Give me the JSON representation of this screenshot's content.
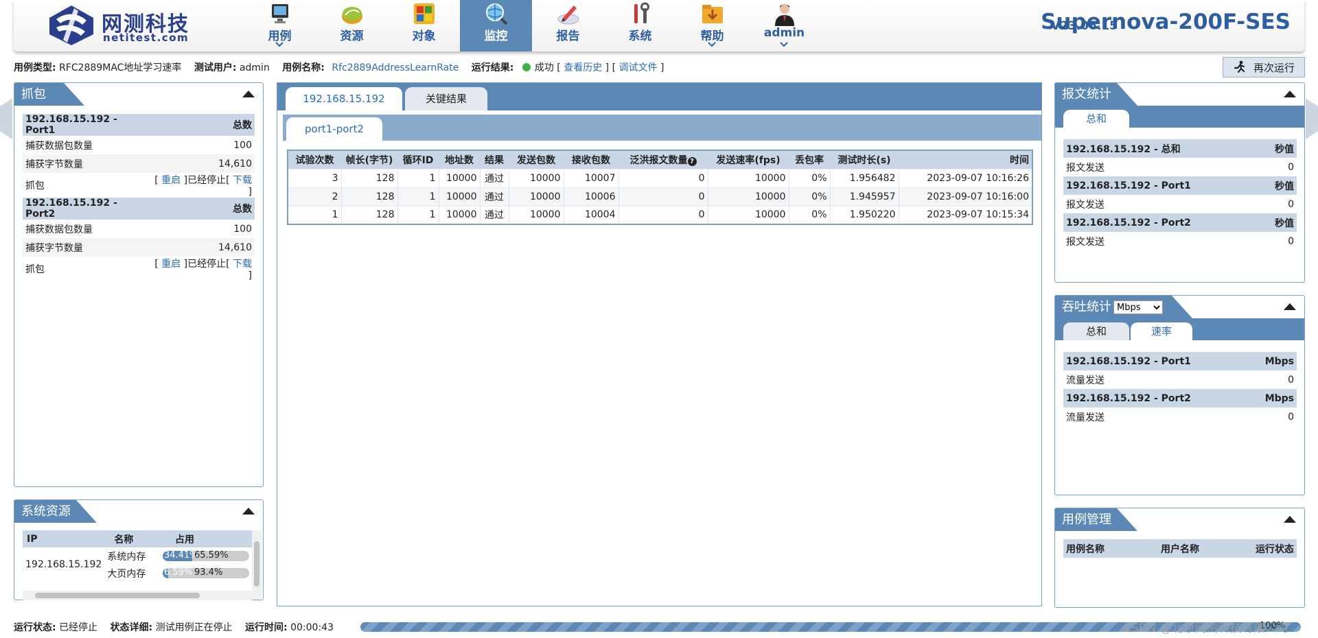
{
  "header": {
    "logo_cn": "网测科技",
    "logo_en": "netitest.com",
    "nav": [
      {
        "label": "用例",
        "has_dropdown": true
      },
      {
        "label": "资源",
        "has_dropdown": false
      },
      {
        "label": "对象",
        "has_dropdown": false
      },
      {
        "label": "监控",
        "has_dropdown": false,
        "active": true
      },
      {
        "label": "报告",
        "has_dropdown": false
      },
      {
        "label": "系统",
        "has_dropdown": false
      },
      {
        "label": "帮助",
        "has_dropdown": true
      },
      {
        "label": "admin",
        "has_dropdown": true
      }
    ],
    "version": "V23.06.15",
    "product": "Supernova-200F-SES"
  },
  "infobar": {
    "case_type_label": "用例类型:",
    "case_type_value": "RFC2889MAC地址学习速率",
    "user_label": "测试用户:",
    "user_value": "admin",
    "case_name_label": "用例名称:",
    "case_name_value": "Rfc2889AddressLearnRate",
    "result_label": "运行结果:",
    "result_value": "成功 [",
    "history_link": "查看历史",
    "sep": "] [",
    "debug_link": "调试文件",
    "close": "]",
    "rerun_button": "再次运行"
  },
  "capture": {
    "title": "抓包",
    "ports": [
      {
        "name": "192.168.15.192 - Port1",
        "total_label": "总数",
        "pkt_label": "捕获数据包数量",
        "pkt_value": "100",
        "byte_label": "捕获字节数量",
        "byte_value": "14,610",
        "cap_label": "抓包",
        "restart": "重启",
        "stopped": "]已经停止[",
        "download": "下载",
        "open": "[",
        "close": "]"
      },
      {
        "name": "192.168.15.192 - Port2",
        "total_label": "总数",
        "pkt_label": "捕获数据包数量",
        "pkt_value": "100",
        "byte_label": "捕获字节数量",
        "byte_value": "14,610",
        "cap_label": "抓包",
        "restart": "重启",
        "stopped": "]已经停止[",
        "download": "下载",
        "open": "[",
        "close": "]"
      }
    ]
  },
  "sysres": {
    "title": "系统资源",
    "headers": [
      "IP",
      "名称",
      "占用"
    ],
    "ip": "192.168.15.192",
    "rows": [
      {
        "name": "系统内存",
        "used": "34.41%",
        "free": "65.59%",
        "used_pct": 34.41
      },
      {
        "name": "大页内存",
        "used": "6.59%",
        "free": "93.4%",
        "used_pct": 6.59
      }
    ]
  },
  "center": {
    "tabs": [
      "192.168.15.192",
      "关键结果"
    ],
    "subtab": "port1-port2",
    "table": {
      "headers": [
        "试验次数",
        "帧长(字节)",
        "循环ID",
        "地址数",
        "结果",
        "发送包数",
        "接收包数",
        "泛洪报文数量",
        "发送速率(fps)",
        "丢包率",
        "测试时长(s)",
        "时间"
      ],
      "rows": [
        [
          "3",
          "128",
          "1",
          "10000",
          "通过",
          "10000",
          "10007",
          "0",
          "10000",
          "0%",
          "1.956482",
          "2023-09-07 10:16:26"
        ],
        [
          "2",
          "128",
          "1",
          "10000",
          "通过",
          "10000",
          "10006",
          "0",
          "10000",
          "0%",
          "1.945957",
          "2023-09-07 10:16:00"
        ],
        [
          "1",
          "128",
          "1",
          "10000",
          "通过",
          "10000",
          "10004",
          "0",
          "10000",
          "0%",
          "1.950220",
          "2023-09-07 10:15:34"
        ]
      ]
    }
  },
  "pktstats": {
    "title": "报文统计",
    "tab": "总和",
    "groups": [
      {
        "name": "192.168.15.192 - 总和",
        "unit": "秒值",
        "label": "报文发送",
        "value": "0"
      },
      {
        "name": "192.168.15.192 - Port1",
        "unit": "秒值",
        "label": "报文发送",
        "value": "0"
      },
      {
        "name": "192.168.15.192 - Port2",
        "unit": "秒值",
        "label": "报文发送",
        "value": "0"
      }
    ]
  },
  "throughput": {
    "title": "吞吐统计",
    "unit_selected": "Mbps",
    "tabs": [
      "总和",
      "速率"
    ],
    "groups": [
      {
        "name": "192.168.15.192 - Port1",
        "unit": "Mbps",
        "label": "流量发送",
        "value": "0"
      },
      {
        "name": "192.168.15.192 - Port2",
        "unit": "Mbps",
        "label": "流量发送",
        "value": "0"
      }
    ]
  },
  "casemgmt": {
    "title": "用例管理",
    "headers": [
      "用例名称",
      "用户名称",
      "运行状态"
    ]
  },
  "footer": {
    "status_label": "运行状态:",
    "status_value": "已经停止",
    "detail_label": "状态详细:",
    "detail_value": "测试用例正在停止",
    "time_label": "运行时间:",
    "time_value": "00:00:43",
    "progress_text": "100%",
    "progress_pct": 100
  },
  "watermark": "CSDN @北京网测科技有限公司",
  "colors": {
    "accent": "#5b88b5",
    "header_row": "#c8d6e6",
    "link": "#2d6bb5",
    "ok": "#3cb44b",
    "brand": "#2d5fa0"
  }
}
